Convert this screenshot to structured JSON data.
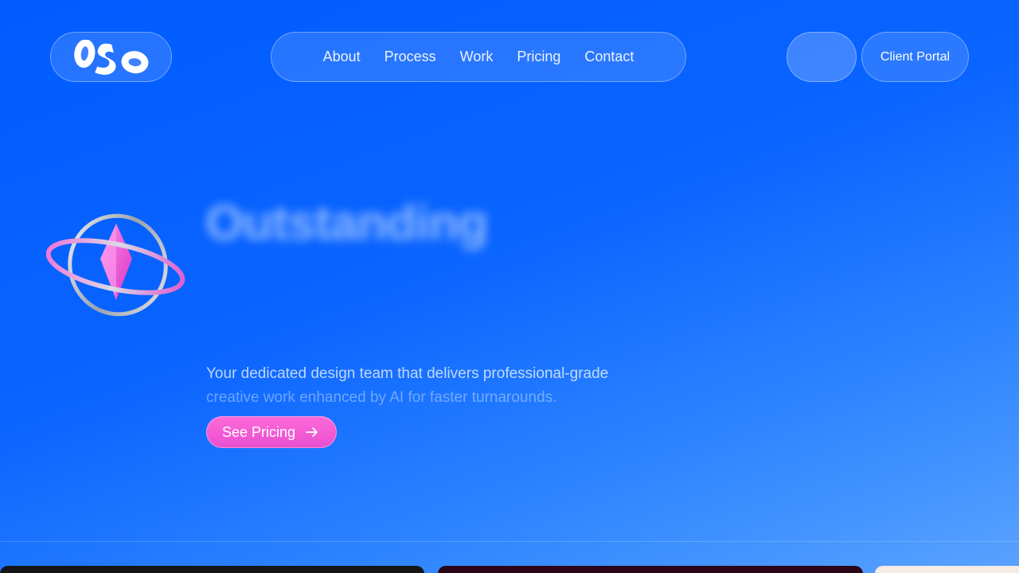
{
  "header": {
    "logo_text": "OSO",
    "nav": [
      {
        "label": "About"
      },
      {
        "label": "Process"
      },
      {
        "label": "Work"
      },
      {
        "label": "Pricing"
      },
      {
        "label": "Contact"
      }
    ],
    "portal_label": "Client Portal"
  },
  "hero": {
    "headline": "Outstanding",
    "subtitle_line1": "Your dedicated design team that delivers professional-grade",
    "subtitle_line2": "creative work enhanced by AI for faster turnarounds.",
    "cta_label": "See Pricing",
    "cta_icon": "arrow-right-icon",
    "illustration_icon": "gem-orbit-icon"
  },
  "colors": {
    "background": "#005cff",
    "cta": "#e84fd0"
  }
}
